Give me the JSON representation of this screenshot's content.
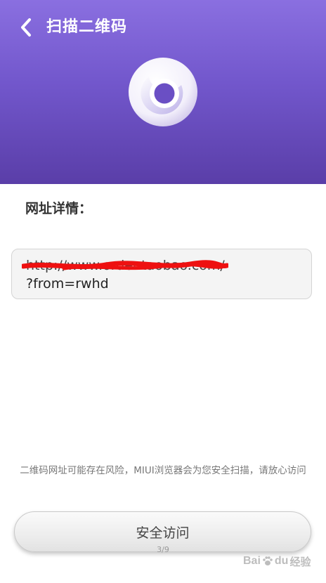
{
  "header": {
    "title": "扫描二维码",
    "background_color": "#7257cc",
    "back_icon": "chevron-left-icon",
    "logo_icon": "miui-browser-logo"
  },
  "details": {
    "label": "网址详情：",
    "url_line1": "http://www.order.taobao.com/",
    "url_line2": "?from=rwhd"
  },
  "notice": {
    "text": "二维码网址可能存在风险，MIUI浏览器会为您安全扫描，请放心访问"
  },
  "actions": {
    "visit_label": "安全访问"
  },
  "page_indicator": "3/9",
  "watermark": {
    "brand": "Bai",
    "brand_suffix": "du",
    "jingyan": "经验"
  }
}
